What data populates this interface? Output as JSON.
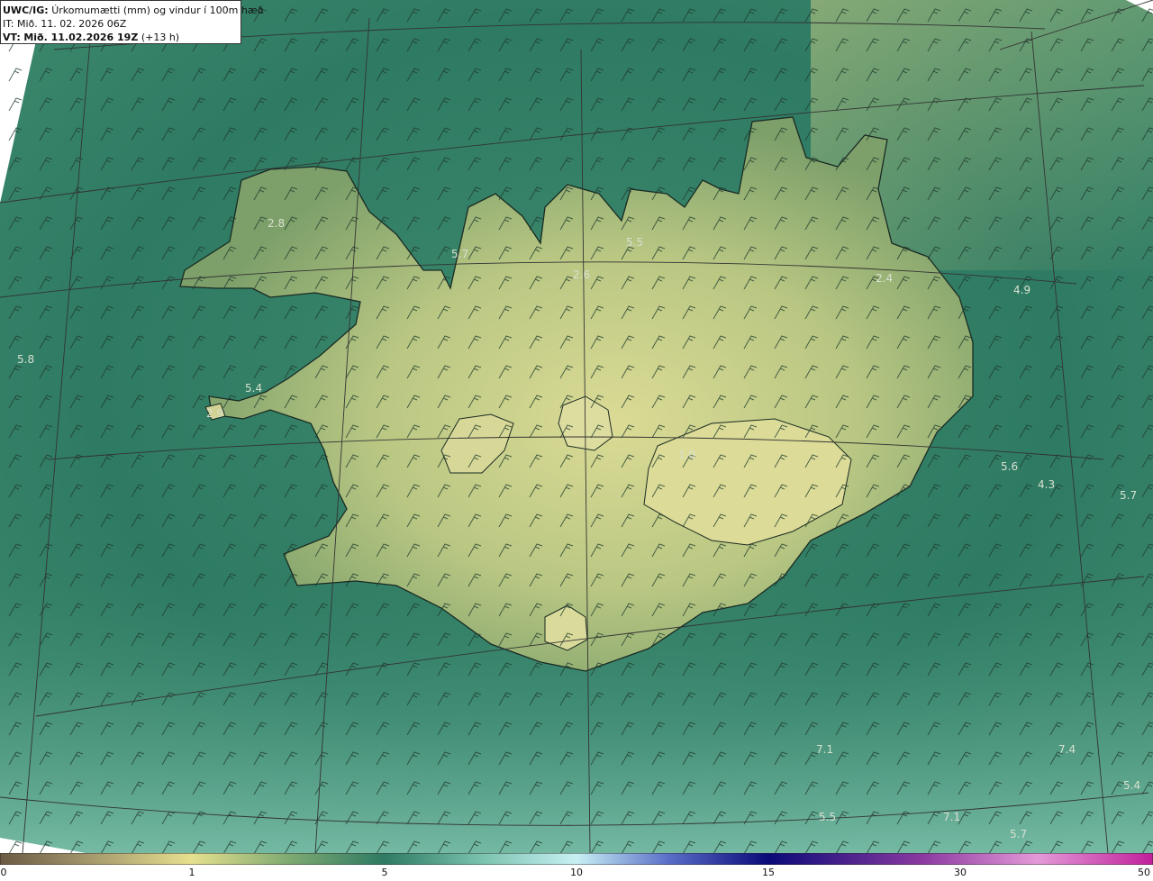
{
  "info": {
    "title_prefix": "UWC/IG:",
    "title_text": "Úrkomumætti (mm) og vindur í 100m hæð",
    "it_line": "IT: Mið. 11. 02. 2026 06Z",
    "vt_prefix": "VT:",
    "vt_bold": "Mið. 11.02.2026 19Z",
    "vt_suffix": "(+13 h)"
  },
  "point_values": [
    "2.8",
    "5.7",
    "5.5",
    "2.6",
    "2.4",
    "4.9",
    "5.8",
    "5.4",
    "2.9",
    "1.0",
    "5.6",
    "4.3",
    "5.7",
    "7.1",
    "7.4",
    "5.4",
    "5.5",
    "7.1",
    "5.7"
  ],
  "colorbar": {
    "labels": [
      "0",
      "1",
      "5",
      "10",
      "15",
      "30",
      "50"
    ]
  },
  "colors": {
    "sea": "#2f7d66",
    "land_low": "#6f9a62",
    "land_high": "#d6d890",
    "coast": "#1a2a22",
    "grid": "#333333"
  }
}
